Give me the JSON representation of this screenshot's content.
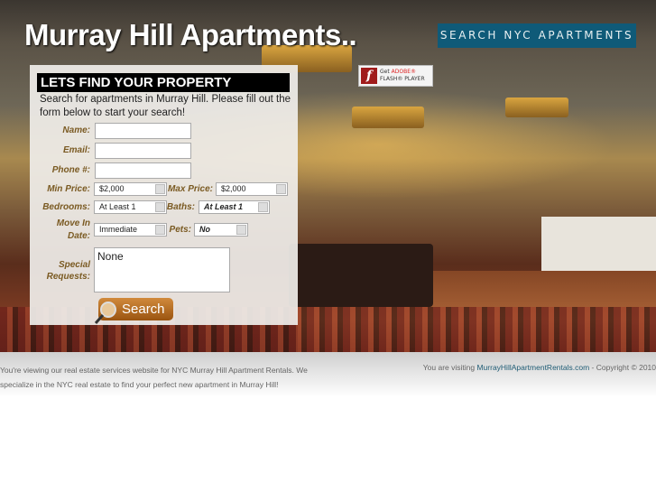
{
  "header": {
    "title": "Murray Hill Apartments..",
    "banner": "SEARCH NYC APARTMENTS"
  },
  "flash_badge": {
    "line1": "Get",
    "adobe": "ADOBE®",
    "line2": "FLASH® PLAYER"
  },
  "form": {
    "heading": "LETS FIND YOUR PROPERTY",
    "intro": "Search for apartments in Murray Hill. Please fill out the form below to start your search!",
    "name_label": "Name:",
    "email_label": "Email:",
    "phone_label": "Phone #:",
    "min_price_label": "Min Price:",
    "min_price": "$2,000",
    "max_price_label": "Max Price:",
    "max_price": "$2,000",
    "bedrooms_label": "Bedrooms:",
    "bedrooms": "At Least 1",
    "baths_label": "Baths:",
    "baths": "At Least 1",
    "move_in_label_1": "Move In",
    "move_in_label_2": "Date:",
    "move_in": "Immediate",
    "pets_label": "Pets:",
    "pets": "No",
    "special_label_1": "Special",
    "special_label_2": "Requests:",
    "special": "None",
    "search_button": "Search"
  },
  "footer": {
    "left_1": "You're viewing our real estate services website for NYC Murray Hill Apartment Rentals. We",
    "left_2": "specialize in the NYC real estate to find your perfect new apartment in Murray Hill!",
    "right_prefix": "You are visiting ",
    "right_link": "MurrayHillApartmentRentals.com",
    "right_suffix": " - Copyright © 2010"
  },
  "colors": {
    "banner": "#0f5a78",
    "label": "#7a5a22",
    "button": "#b86a20"
  }
}
